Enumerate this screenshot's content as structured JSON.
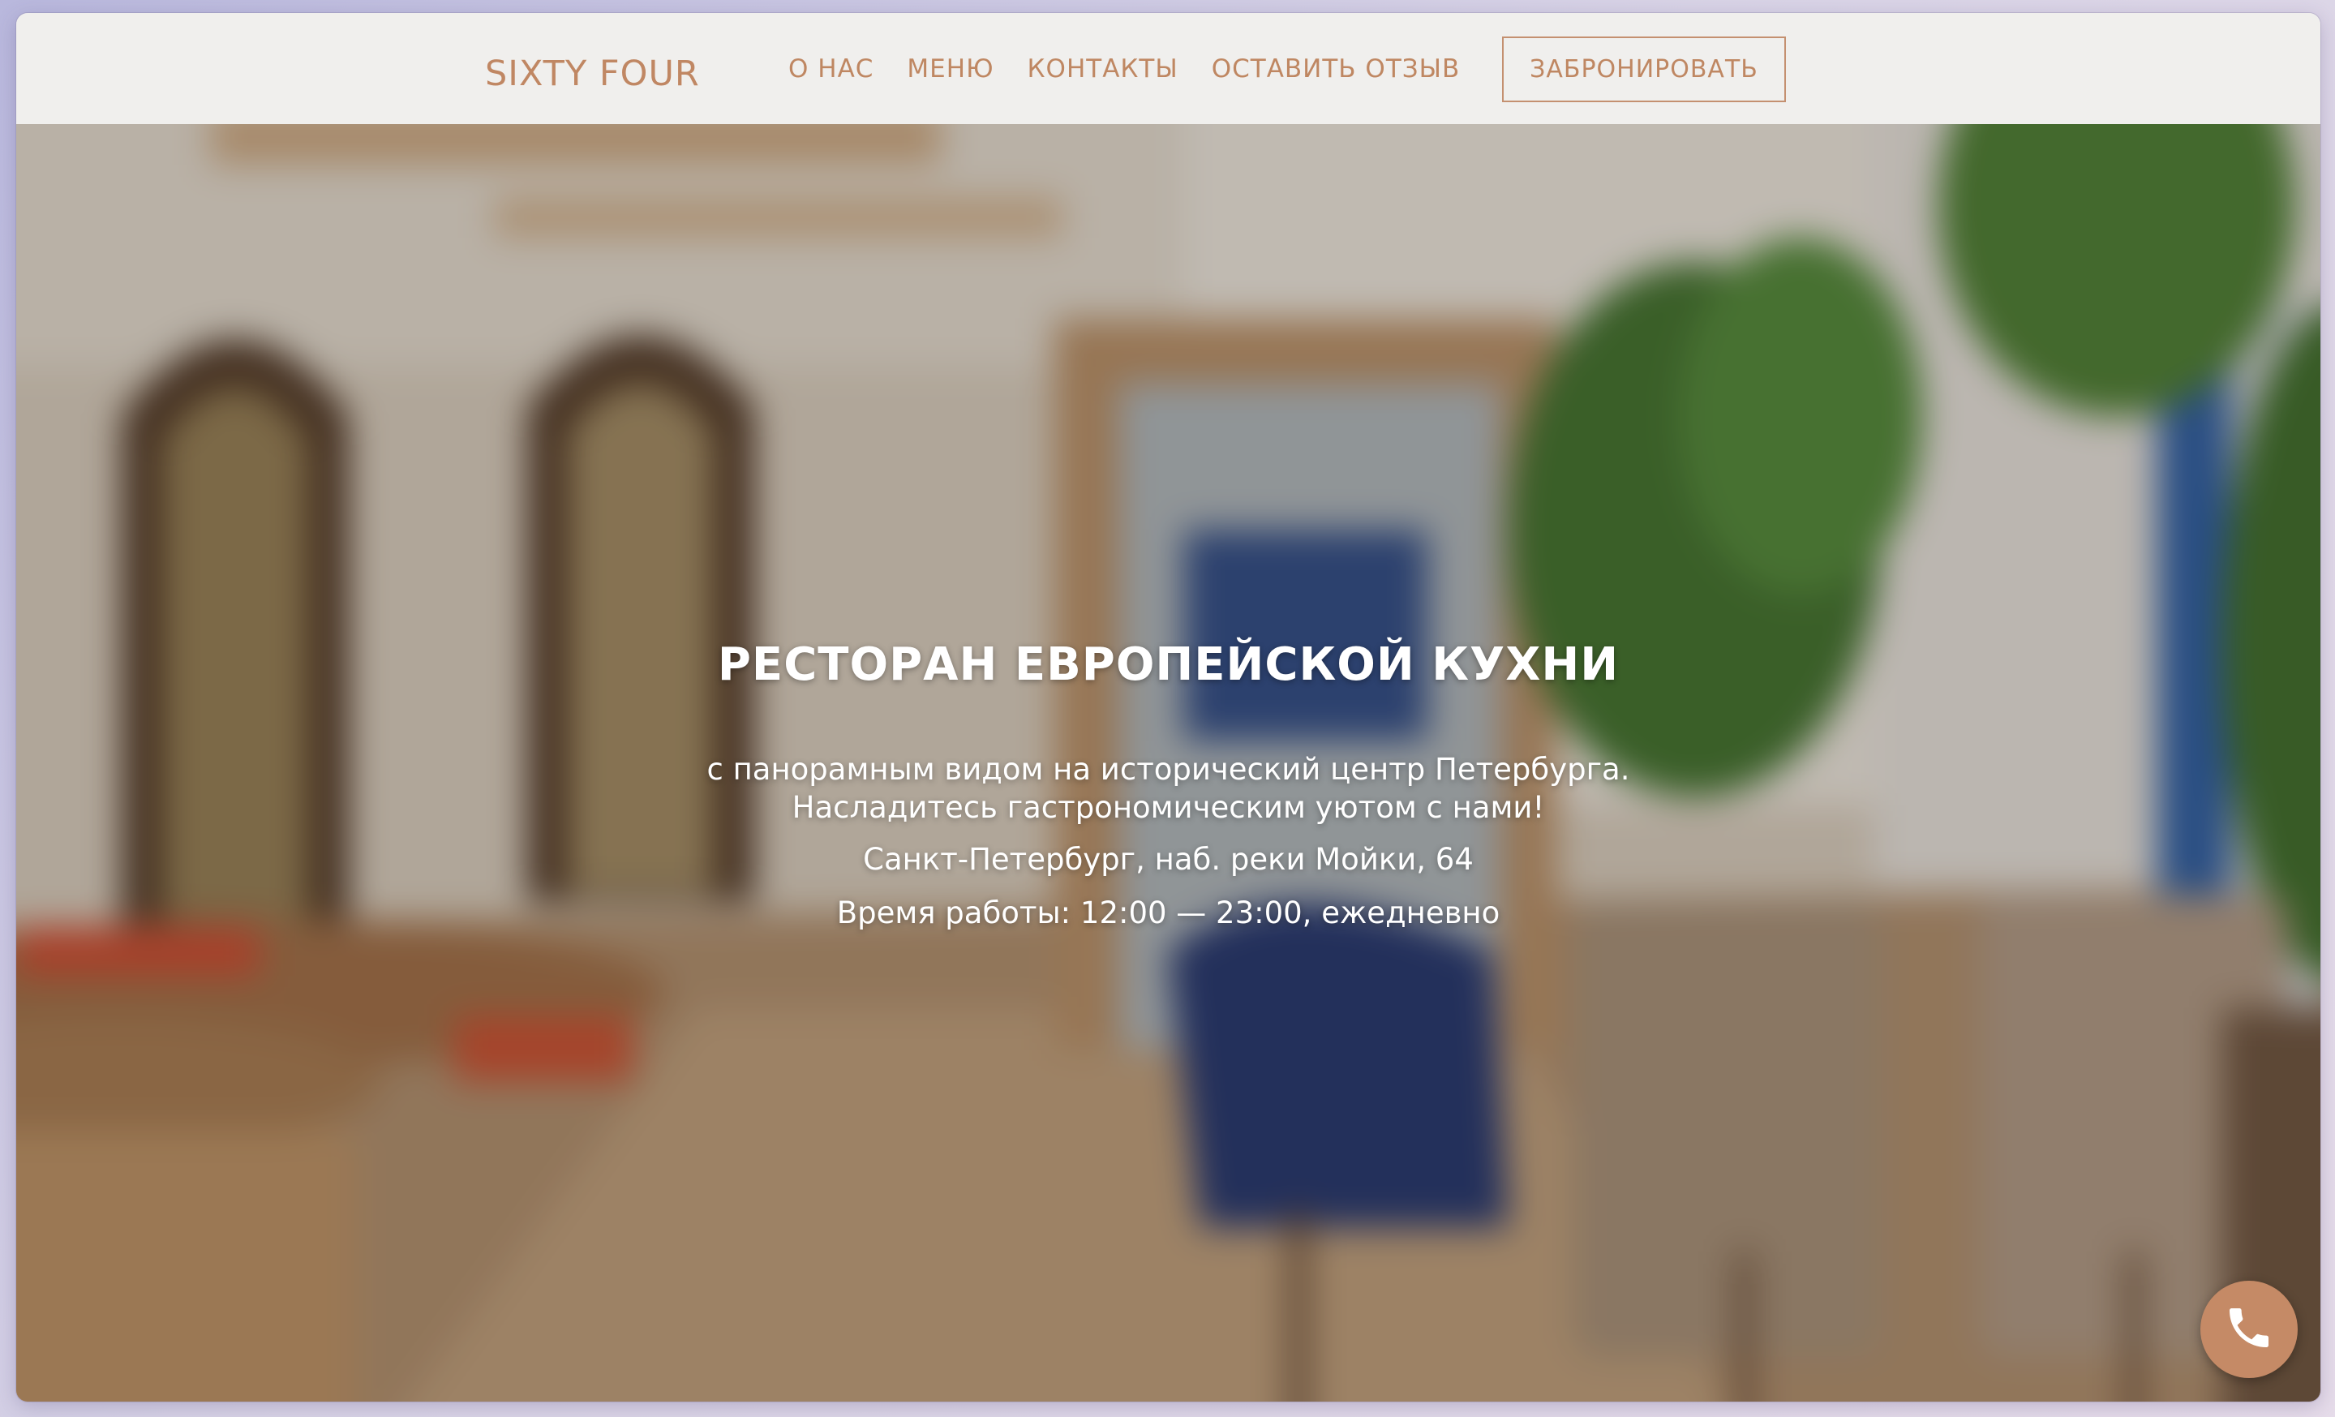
{
  "header": {
    "logo": "SIXTY FOUR",
    "nav": [
      {
        "label": "О НАС"
      },
      {
        "label": "МЕНЮ"
      },
      {
        "label": "КОНТАКТЫ"
      },
      {
        "label": "ОСТАВИТЬ ОТЗЫВ"
      }
    ],
    "book_button": "ЗАБРОНИРОВАТЬ"
  },
  "hero": {
    "title": "РЕСТОРАН ЕВРОПЕЙСКОЙ КУХНИ",
    "subtitle_line1": "с панорамным видом на исторический центр Петербурга.",
    "subtitle_line2": "Насладитесь гастрономическим уютом с нами!",
    "address": "Санкт-Петербург, наб. реки Мойки, 64",
    "hours": "Время работы: 12:00 — 23:00, ежедневно"
  },
  "floating": {
    "call_icon": "phone-icon"
  },
  "colors": {
    "accent": "#c08763",
    "header_bg": "#f0efed",
    "call_button": "#c58a66"
  }
}
